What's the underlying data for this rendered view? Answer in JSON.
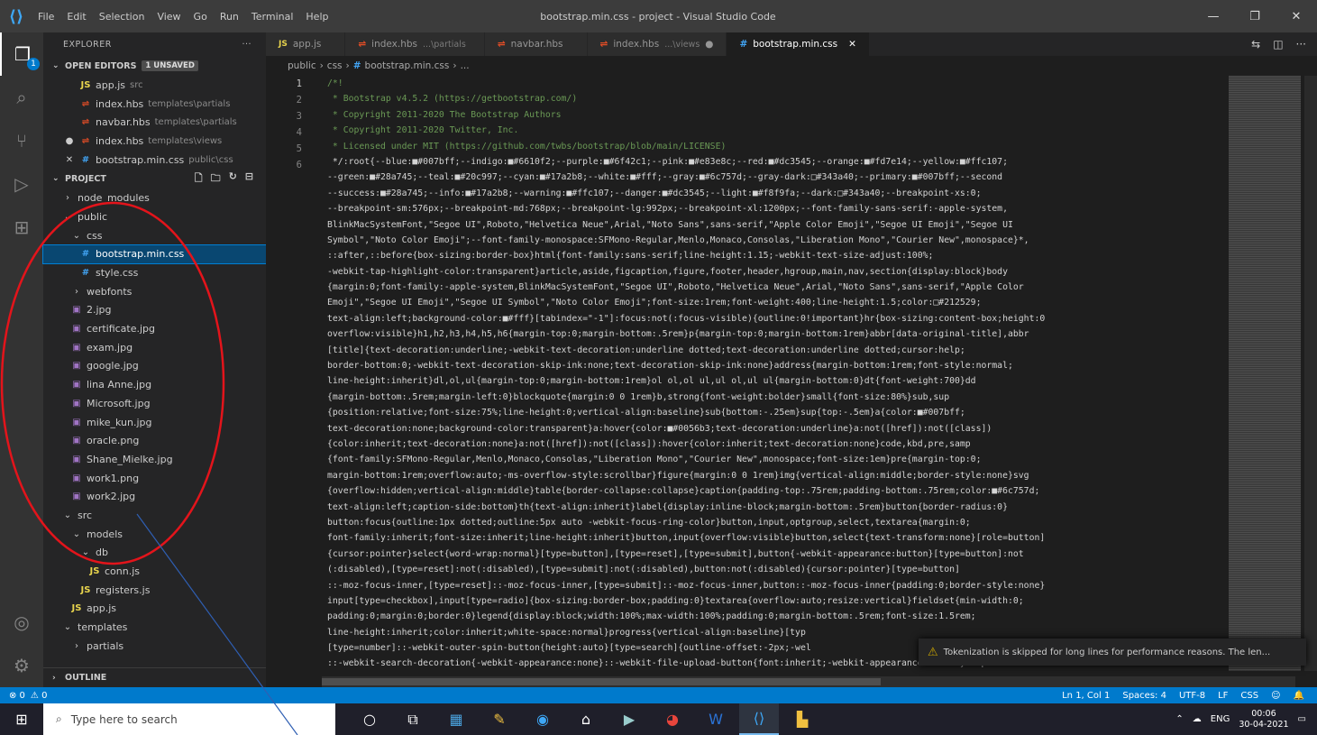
{
  "window": {
    "title": "bootstrap.min.css - project - Visual Studio Code",
    "menu": [
      "File",
      "Edit",
      "Selection",
      "View",
      "Go",
      "Run",
      "Terminal",
      "Help"
    ]
  },
  "sidebar": {
    "header": "EXPLORER",
    "open_editors": {
      "title": "OPEN EDITORS",
      "badge": "1 UNSAVED",
      "items": [
        {
          "prefix": "",
          "icon": "JS",
          "name": "app.js",
          "desc": "src"
        },
        {
          "prefix": "",
          "icon": "html",
          "name": "index.hbs",
          "desc": "templates\\partials"
        },
        {
          "prefix": "",
          "icon": "html",
          "name": "navbar.hbs",
          "desc": "templates\\partials"
        },
        {
          "prefix": "●",
          "icon": "html",
          "name": "index.hbs",
          "desc": "templates\\views"
        },
        {
          "prefix": "✕",
          "icon": "css",
          "name": "bootstrap.min.css",
          "desc": "public\\css"
        }
      ]
    },
    "project": {
      "title": "PROJECT",
      "tree": [
        {
          "indent": 1,
          "chev": "›",
          "icon": "",
          "name": "node_modules"
        },
        {
          "indent": 1,
          "chev": "⌄",
          "icon": "",
          "name": "public"
        },
        {
          "indent": 2,
          "chev": "⌄",
          "icon": "",
          "name": "css"
        },
        {
          "indent": 3,
          "chev": "",
          "icon": "css",
          "name": "bootstrap.min.css",
          "selected": true
        },
        {
          "indent": 3,
          "chev": "",
          "icon": "css",
          "name": "style.css"
        },
        {
          "indent": 2,
          "chev": "›",
          "icon": "",
          "name": "webfonts"
        },
        {
          "indent": 2,
          "chev": "",
          "icon": "img",
          "name": "2.jpg"
        },
        {
          "indent": 2,
          "chev": "",
          "icon": "img",
          "name": "certificate.jpg"
        },
        {
          "indent": 2,
          "chev": "",
          "icon": "img",
          "name": "exam.jpg"
        },
        {
          "indent": 2,
          "chev": "",
          "icon": "img",
          "name": "google.jpg"
        },
        {
          "indent": 2,
          "chev": "",
          "icon": "img",
          "name": "lina Anne.jpg"
        },
        {
          "indent": 2,
          "chev": "",
          "icon": "img",
          "name": "Microsoft.jpg"
        },
        {
          "indent": 2,
          "chev": "",
          "icon": "img",
          "name": "mike_kun.jpg"
        },
        {
          "indent": 2,
          "chev": "",
          "icon": "img",
          "name": "oracle.png"
        },
        {
          "indent": 2,
          "chev": "",
          "icon": "img",
          "name": "Shane_Mielke.jpg"
        },
        {
          "indent": 2,
          "chev": "",
          "icon": "img",
          "name": "work1.png"
        },
        {
          "indent": 2,
          "chev": "",
          "icon": "img",
          "name": "work2.jpg"
        },
        {
          "indent": 1,
          "chev": "⌄",
          "icon": "",
          "name": "src"
        },
        {
          "indent": 2,
          "chev": "⌄",
          "icon": "",
          "name": "models"
        },
        {
          "indent": 3,
          "chev": "⌄",
          "icon": "",
          "name": "db"
        },
        {
          "indent": 4,
          "chev": "",
          "icon": "JS",
          "name": "conn.js"
        },
        {
          "indent": 3,
          "chev": "",
          "icon": "JS",
          "name": "registers.js"
        },
        {
          "indent": 2,
          "chev": "",
          "icon": "JS",
          "name": "app.js"
        },
        {
          "indent": 1,
          "chev": "⌄",
          "icon": "",
          "name": "templates"
        },
        {
          "indent": 2,
          "chev": "›",
          "icon": "",
          "name": "partials"
        }
      ]
    },
    "outline": "OUTLINE"
  },
  "tabs": [
    {
      "icon": "JS",
      "name": "app.js",
      "desc": "",
      "state": "",
      "active": false
    },
    {
      "icon": "html",
      "name": "index.hbs",
      "desc": "...\\partials",
      "state": "",
      "active": false
    },
    {
      "icon": "html",
      "name": "navbar.hbs",
      "desc": "",
      "state": "",
      "active": false
    },
    {
      "icon": "html",
      "name": "index.hbs",
      "desc": "...\\views",
      "state": "●",
      "active": false
    },
    {
      "icon": "css",
      "name": "bootstrap.min.css",
      "desc": "",
      "state": "✕",
      "active": true
    }
  ],
  "breadcrumb": [
    "public",
    "css",
    "bootstrap.min.css",
    "..."
  ],
  "code": {
    "line_numbers": [
      "1",
      "2",
      "3",
      "4",
      "5",
      "6"
    ],
    "lines": [
      {
        "cls": "cm",
        "text": "/*!"
      },
      {
        "cls": "cm",
        "text": " * Bootstrap v4.5.2 (https://getbootstrap.com/)"
      },
      {
        "cls": "cm",
        "text": " * Copyright 2011-2020 The Bootstrap Authors"
      },
      {
        "cls": "cm",
        "text": " * Copyright 2011-2020 Twitter, Inc."
      },
      {
        "cls": "cm",
        "text": " * Licensed under MIT (https://github.com/twbs/bootstrap/blob/main/LICENSE)"
      },
      {
        "cls": "",
        "text": " */:root{--blue:■#007bff;--indigo:■#6610f2;--purple:■#6f42c1;--pink:■#e83e8c;--red:■#dc3545;--orange:■#fd7e14;--yellow:■#ffc107;"
      },
      {
        "cls": "",
        "text": "--green:■#28a745;--teal:■#20c997;--cyan:■#17a2b8;--white:■#fff;--gray:■#6c757d;--gray-dark:□#343a40;--primary:■#007bff;--second"
      },
      {
        "cls": "",
        "text": "--success:■#28a745;--info:■#17a2b8;--warning:■#ffc107;--danger:■#dc3545;--light:■#f8f9fa;--dark:□#343a40;--breakpoint-xs:0;"
      },
      {
        "cls": "",
        "text": "--breakpoint-sm:576px;--breakpoint-md:768px;--breakpoint-lg:992px;--breakpoint-xl:1200px;--font-family-sans-serif:-apple-system,"
      },
      {
        "cls": "",
        "text": "BlinkMacSystemFont,\"Segoe UI\",Roboto,\"Helvetica Neue\",Arial,\"Noto Sans\",sans-serif,\"Apple Color Emoji\",\"Segoe UI Emoji\",\"Segoe UI"
      },
      {
        "cls": "",
        "text": "Symbol\",\"Noto Color Emoji\";--font-family-monospace:SFMono-Regular,Menlo,Monaco,Consolas,\"Liberation Mono\",\"Courier New\",monospace}*,"
      },
      {
        "cls": "",
        "text": "::after,::before{box-sizing:border-box}html{font-family:sans-serif;line-height:1.15;-webkit-text-size-adjust:100%;"
      },
      {
        "cls": "",
        "text": "-webkit-tap-highlight-color:transparent}article,aside,figcaption,figure,footer,header,hgroup,main,nav,section{display:block}body"
      },
      {
        "cls": "",
        "text": "{margin:0;font-family:-apple-system,BlinkMacSystemFont,\"Segoe UI\",Roboto,\"Helvetica Neue\",Arial,\"Noto Sans\",sans-serif,\"Apple Color"
      },
      {
        "cls": "",
        "text": "Emoji\",\"Segoe UI Emoji\",\"Segoe UI Symbol\",\"Noto Color Emoji\";font-size:1rem;font-weight:400;line-height:1.5;color:□#212529;"
      },
      {
        "cls": "",
        "text": "text-align:left;background-color:■#fff}[tabindex=\"-1\"]:focus:not(:focus-visible){outline:0!important}hr{box-sizing:content-box;height:0"
      },
      {
        "cls": "",
        "text": "overflow:visible}h1,h2,h3,h4,h5,h6{margin-top:0;margin-bottom:.5rem}p{margin-top:0;margin-bottom:1rem}abbr[data-original-title],abbr"
      },
      {
        "cls": "",
        "text": "[title]{text-decoration:underline;-webkit-text-decoration:underline dotted;text-decoration:underline dotted;cursor:help;"
      },
      {
        "cls": "",
        "text": "border-bottom:0;-webkit-text-decoration-skip-ink:none;text-decoration-skip-ink:none}address{margin-bottom:1rem;font-style:normal;"
      },
      {
        "cls": "",
        "text": "line-height:inherit}dl,ol,ul{margin-top:0;margin-bottom:1rem}ol ol,ol ul,ul ol,ul ul{margin-bottom:0}dt{font-weight:700}dd"
      },
      {
        "cls": "",
        "text": "{margin-bottom:.5rem;margin-left:0}blockquote{margin:0 0 1rem}b,strong{font-weight:bolder}small{font-size:80%}sub,sup"
      },
      {
        "cls": "",
        "text": "{position:relative;font-size:75%;line-height:0;vertical-align:baseline}sub{bottom:-.25em}sup{top:-.5em}a{color:■#007bff;"
      },
      {
        "cls": "",
        "text": "text-decoration:none;background-color:transparent}a:hover{color:■#0056b3;text-decoration:underline}a:not([href]):not([class])"
      },
      {
        "cls": "",
        "text": "{color:inherit;text-decoration:none}a:not([href]):not([class]):hover{color:inherit;text-decoration:none}code,kbd,pre,samp"
      },
      {
        "cls": "",
        "text": "{font-family:SFMono-Regular,Menlo,Monaco,Consolas,\"Liberation Mono\",\"Courier New\",monospace;font-size:1em}pre{margin-top:0;"
      },
      {
        "cls": "",
        "text": "margin-bottom:1rem;overflow:auto;-ms-overflow-style:scrollbar}figure{margin:0 0 1rem}img{vertical-align:middle;border-style:none}svg"
      },
      {
        "cls": "",
        "text": "{overflow:hidden;vertical-align:middle}table{border-collapse:collapse}caption{padding-top:.75rem;padding-bottom:.75rem;color:■#6c757d;"
      },
      {
        "cls": "",
        "text": "text-align:left;caption-side:bottom}th{text-align:inherit}label{display:inline-block;margin-bottom:.5rem}button{border-radius:0}"
      },
      {
        "cls": "",
        "text": "button:focus{outline:1px dotted;outline:5px auto -webkit-focus-ring-color}button,input,optgroup,select,textarea{margin:0;"
      },
      {
        "cls": "",
        "text": "font-family:inherit;font-size:inherit;line-height:inherit}button,input{overflow:visible}button,select{text-transform:none}[role=button]"
      },
      {
        "cls": "",
        "text": "{cursor:pointer}select{word-wrap:normal}[type=button],[type=reset],[type=submit],button{-webkit-appearance:button}[type=button]:not"
      },
      {
        "cls": "",
        "text": "(:disabled),[type=reset]:not(:disabled),[type=submit]:not(:disabled),button:not(:disabled){cursor:pointer}[type=button]"
      },
      {
        "cls": "",
        "text": "::-moz-focus-inner,[type=reset]::-moz-focus-inner,[type=submit]::-moz-focus-inner,button::-moz-focus-inner{padding:0;border-style:none}"
      },
      {
        "cls": "",
        "text": "input[type=checkbox],input[type=radio]{box-sizing:border-box;padding:0}textarea{overflow:auto;resize:vertical}fieldset{min-width:0;"
      },
      {
        "cls": "",
        "text": "padding:0;margin:0;border:0}legend{display:block;width:100%;max-width:100%;padding:0;margin-bottom:.5rem;font-size:1.5rem;"
      },
      {
        "cls": "",
        "text": "line-height:inherit;color:inherit;white-space:normal}progress{vertical-align:baseline}[typ"
      },
      {
        "cls": "",
        "text": "[type=number]::-webkit-outer-spin-button{height:auto}[type=search]{outline-offset:-2px;-wel"
      },
      {
        "cls": "",
        "text": "::-webkit-search-decoration{-webkit-appearance:none}::-webkit-file-upload-button{font:inherit;-webkit-appearance:button}output"
      }
    ]
  },
  "toast": "Tokenization is skipped for long lines for performance reasons. The len...",
  "statusbar": {
    "left": [
      "⊗ 0",
      "⚠ 0"
    ],
    "right": [
      "Ln 1, Col 1",
      "Spaces: 4",
      "UTF-8",
      "LF",
      "CSS",
      "☺",
      "🔔"
    ]
  },
  "taskbar": {
    "search_placeholder": "Type here to search",
    "time": "00:06",
    "date": "30-04-2021",
    "lang": "ENG"
  },
  "colors": {
    "accent": "#007acc",
    "annotation": "#e3141b",
    "line": "#2f5fb3"
  }
}
